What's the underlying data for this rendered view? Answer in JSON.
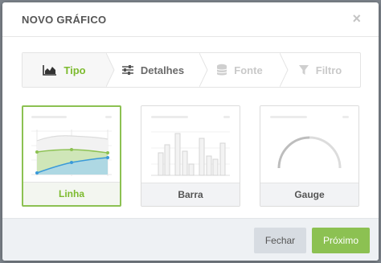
{
  "modal": {
    "title": "NOVO GRÁFICO",
    "close_glyph": "×"
  },
  "steps": [
    {
      "label": "Tipo",
      "icon": "area-chart-icon",
      "state": "active"
    },
    {
      "label": "Detalhes",
      "icon": "sliders-icon",
      "state": "enabled"
    },
    {
      "label": "Fonte",
      "icon": "database-icon",
      "state": "disabled"
    },
    {
      "label": "Filtro",
      "icon": "filter-icon",
      "state": "disabled"
    }
  ],
  "chart_types": [
    {
      "label": "Linha",
      "selected": true
    },
    {
      "label": "Barra",
      "selected": false
    },
    {
      "label": "Gauge",
      "selected": false
    }
  ],
  "footer": {
    "close_label": "Fechar",
    "next_label": "Próximo"
  },
  "colors": {
    "accent": "#8cc152",
    "accent_text": "#7dbb2f",
    "line_blue": "#3a9ad9",
    "disabled": "#c9c9c9"
  }
}
